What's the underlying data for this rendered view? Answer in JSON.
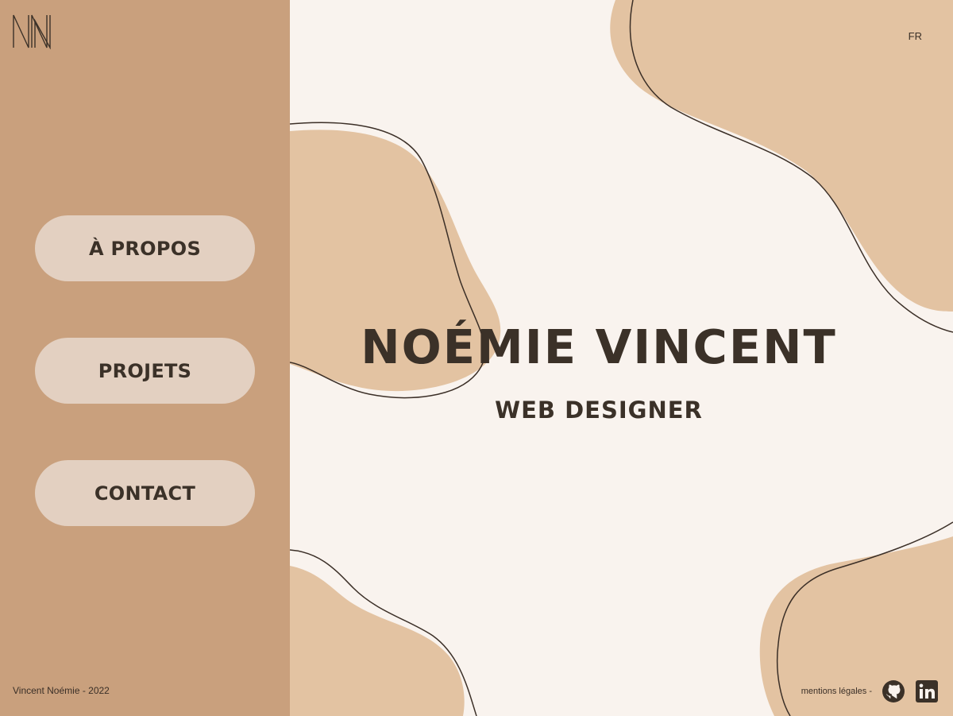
{
  "brand": {
    "logo_icon": "nn-monogram-icon"
  },
  "nav": {
    "items": [
      {
        "label": "À PROPOS"
      },
      {
        "label": "PROJETS"
      },
      {
        "label": "CONTACT"
      }
    ]
  },
  "header": {
    "language": "FR"
  },
  "hero": {
    "name": "NOÉMIE VINCENT",
    "role": "WEB DESIGNER"
  },
  "footer": {
    "copyright": "Vincent Noémie - 2022",
    "legal": "mentions légales -",
    "social": [
      {
        "icon": "github-icon"
      },
      {
        "icon": "linkedin-icon"
      }
    ]
  },
  "colors": {
    "sidebar": "#c9a07d",
    "background": "#f9f3ee",
    "blob": "#e3c3a2",
    "button": "#e3d0c1",
    "text": "#3b3128"
  }
}
